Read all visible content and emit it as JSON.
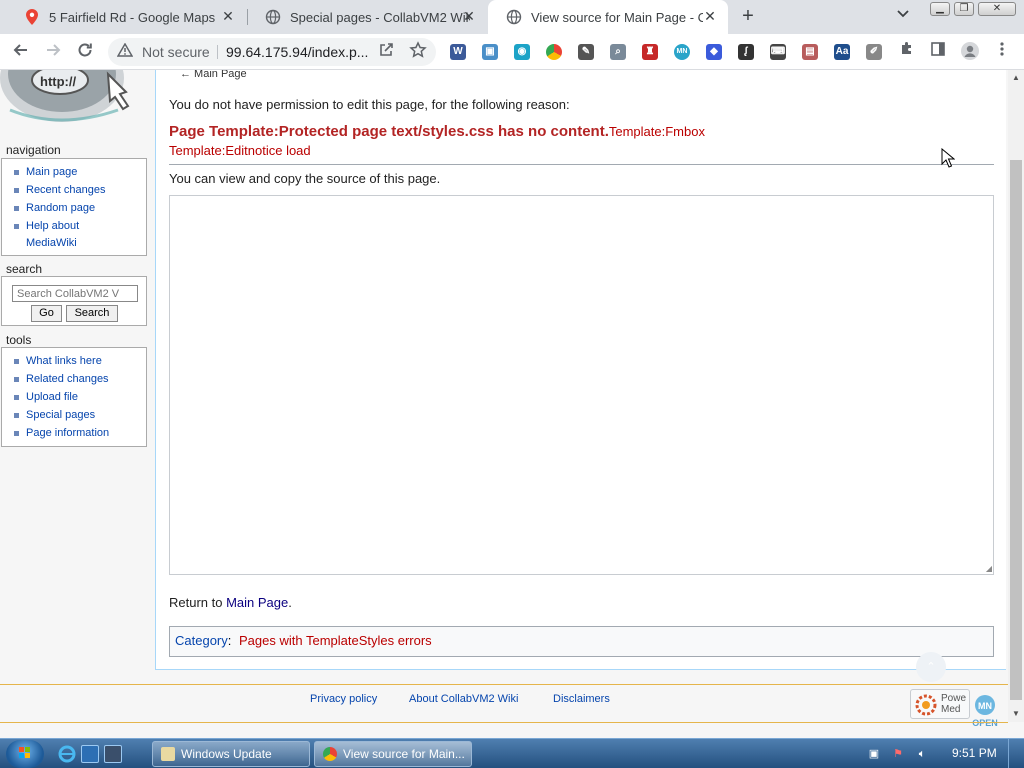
{
  "browser": {
    "tabs": [
      {
        "title": "5 Fairfield Rd - Google Maps",
        "icon": "google-maps-pin-icon"
      },
      {
        "title": "Special pages - CollabVM2 Wiki",
        "icon": "globe-icon"
      },
      {
        "title": "View source for Main Page - Coll",
        "icon": "globe-icon"
      }
    ],
    "new_tab": "+",
    "security_label": "Not secure",
    "url": "99.64.175.94/index.p..."
  },
  "sidebar": {
    "navigation_title": "navigation",
    "navigation_items": [
      "Main page",
      "Recent changes",
      "Random page",
      "Help about",
      "MediaWiki"
    ],
    "search_title": "search",
    "search_placeholder": "Search CollabVM2 V",
    "go_label": "Go",
    "search_label": "Search",
    "tools_title": "tools",
    "tools_items": [
      "What links here",
      "Related changes",
      "Upload file",
      "Special pages",
      "Page information"
    ]
  },
  "content": {
    "backlink": "← Main Page",
    "permission_text": "You do not have permission to edit this page, for the following reason:",
    "error_bold": "Page Template:Protected page text/styles.css has no content.",
    "error_link_1": "Template:Fmbox",
    "error_link_2": "Template:Editnotice load",
    "view_copy_text": "You can view and copy the source of this page.",
    "return_prefix": "Return to ",
    "return_link": "Main Page",
    "return_suffix": ".",
    "category_label": "Category",
    "category_sep": ":",
    "category_value": "Pages with TemplateStyles errors"
  },
  "footer": {
    "privacy": "Privacy policy",
    "about": "About CollabVM2 Wiki",
    "disclaimers": "Disclaimers",
    "powered_text": "Powe\nMed",
    "open_badge": "OPEN"
  },
  "taskbar": {
    "windows_update": "Windows Update",
    "chrome_window": "View source for Main...",
    "clock": "9:51 PM"
  },
  "colors": {
    "link": "#0645ad",
    "redlink": "#ba0000",
    "error": "#b32424",
    "footer_border": "#e5b54b"
  }
}
